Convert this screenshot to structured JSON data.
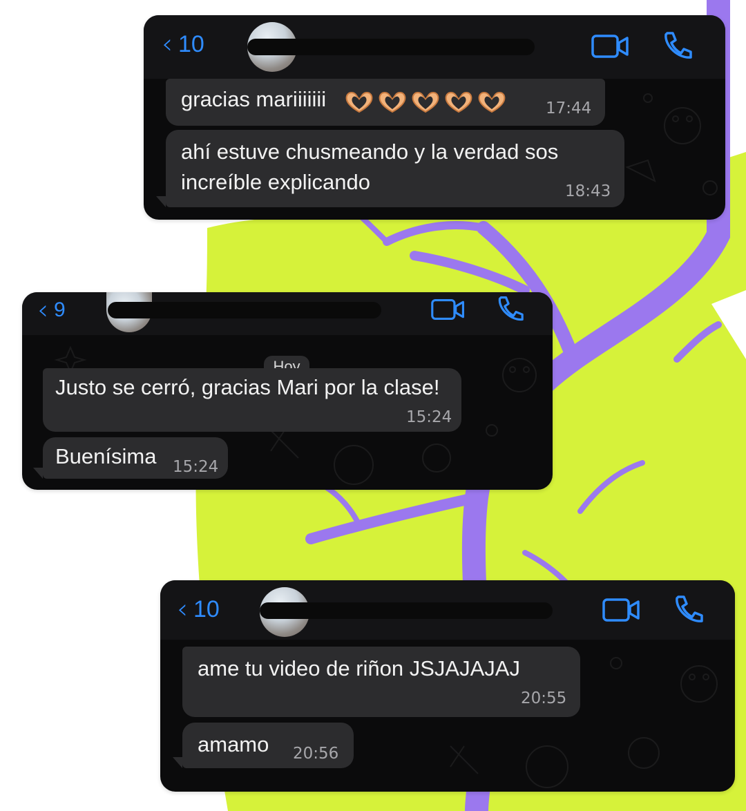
{
  "chats": [
    {
      "back_count": "10",
      "messages": [
        {
          "text": "gracias mariiiiiii",
          "emojis": "heart-hands-icon x5",
          "time": "17:44"
        },
        {
          "text": "ahí estuve chusmeando y la verdad sos\nincreíble explicando",
          "time": "18:43"
        }
      ]
    },
    {
      "back_count": "9",
      "day_label": "Hoy",
      "messages": [
        {
          "text": "Justo se cerró, gracias Mari por la clase!",
          "time": "15:24"
        },
        {
          "text": "Buenísima",
          "time": "15:24"
        }
      ]
    },
    {
      "back_count": "10",
      "messages": [
        {
          "text": "ame tu video de riñon JSJAJAJAJ",
          "time": "20:55"
        },
        {
          "text": "amamo",
          "time": "20:56"
        }
      ]
    }
  ],
  "icons": {
    "back": "chevron-left-icon",
    "video": "video-camera-icon",
    "phone": "phone-icon",
    "emoji": "heart-hands-icon"
  },
  "colors": {
    "accent": "#2f8cff",
    "bubble": "#2c2c2e",
    "card": "#0b0b0c",
    "lime": "#d6f23a",
    "purple": "#9b78ee"
  }
}
